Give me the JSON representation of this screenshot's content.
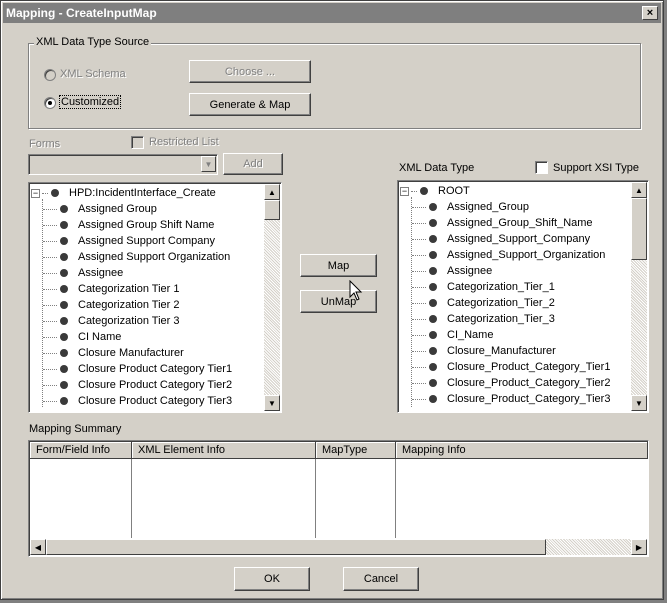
{
  "window": {
    "title": "Mapping - CreateInputMap",
    "close_glyph": "×"
  },
  "source_group": {
    "title": "XML Data Type Source",
    "xml_schema_label": "XML Schema",
    "customized_label": "Customized",
    "selected": "Customized",
    "choose_button": "Choose ...",
    "generate_button": "Generate & Map"
  },
  "forms": {
    "label": "Forms",
    "restricted_list_label": "Restricted List",
    "combo_value": "",
    "add_button": "Add"
  },
  "form_tree": {
    "root": "HPD:IncidentInterface_Create",
    "items": [
      "Assigned Group",
      "Assigned Group Shift Name",
      "Assigned Support Company",
      "Assigned Support Organization",
      "Assignee",
      "Categorization Tier 1",
      "Categorization Tier 2",
      "Categorization Tier 3",
      "CI Name",
      "Closure Manufacturer",
      "Closure Product Category Tier1",
      "Closure Product Category Tier2",
      "Closure Product Category Tier3"
    ]
  },
  "xml_data_type": {
    "label": "XML Data Type",
    "support_xsi_label": "Support XSI Type",
    "root": "ROOT",
    "items": [
      "Assigned_Group",
      "Assigned_Group_Shift_Name",
      "Assigned_Support_Company",
      "Assigned_Support_Organization",
      "Assignee",
      "Categorization_Tier_1",
      "Categorization_Tier_2",
      "Categorization_Tier_3",
      "CI_Name",
      "Closure_Manufacturer",
      "Closure_Product_Category_Tier1",
      "Closure_Product_Category_Tier2",
      "Closure_Product_Category_Tier3"
    ]
  },
  "actions": {
    "map_button": "Map",
    "unmap_button": "UnMap"
  },
  "mapping_summary": {
    "label": "Mapping Summary",
    "columns": [
      "Form/Field Info",
      "XML Element Info",
      "MapType",
      "Mapping Info"
    ]
  },
  "footer": {
    "ok_button": "OK",
    "cancel_button": "Cancel"
  },
  "icons": {
    "tree_node": "tree-node-icon",
    "expander": "collapse-icon"
  }
}
